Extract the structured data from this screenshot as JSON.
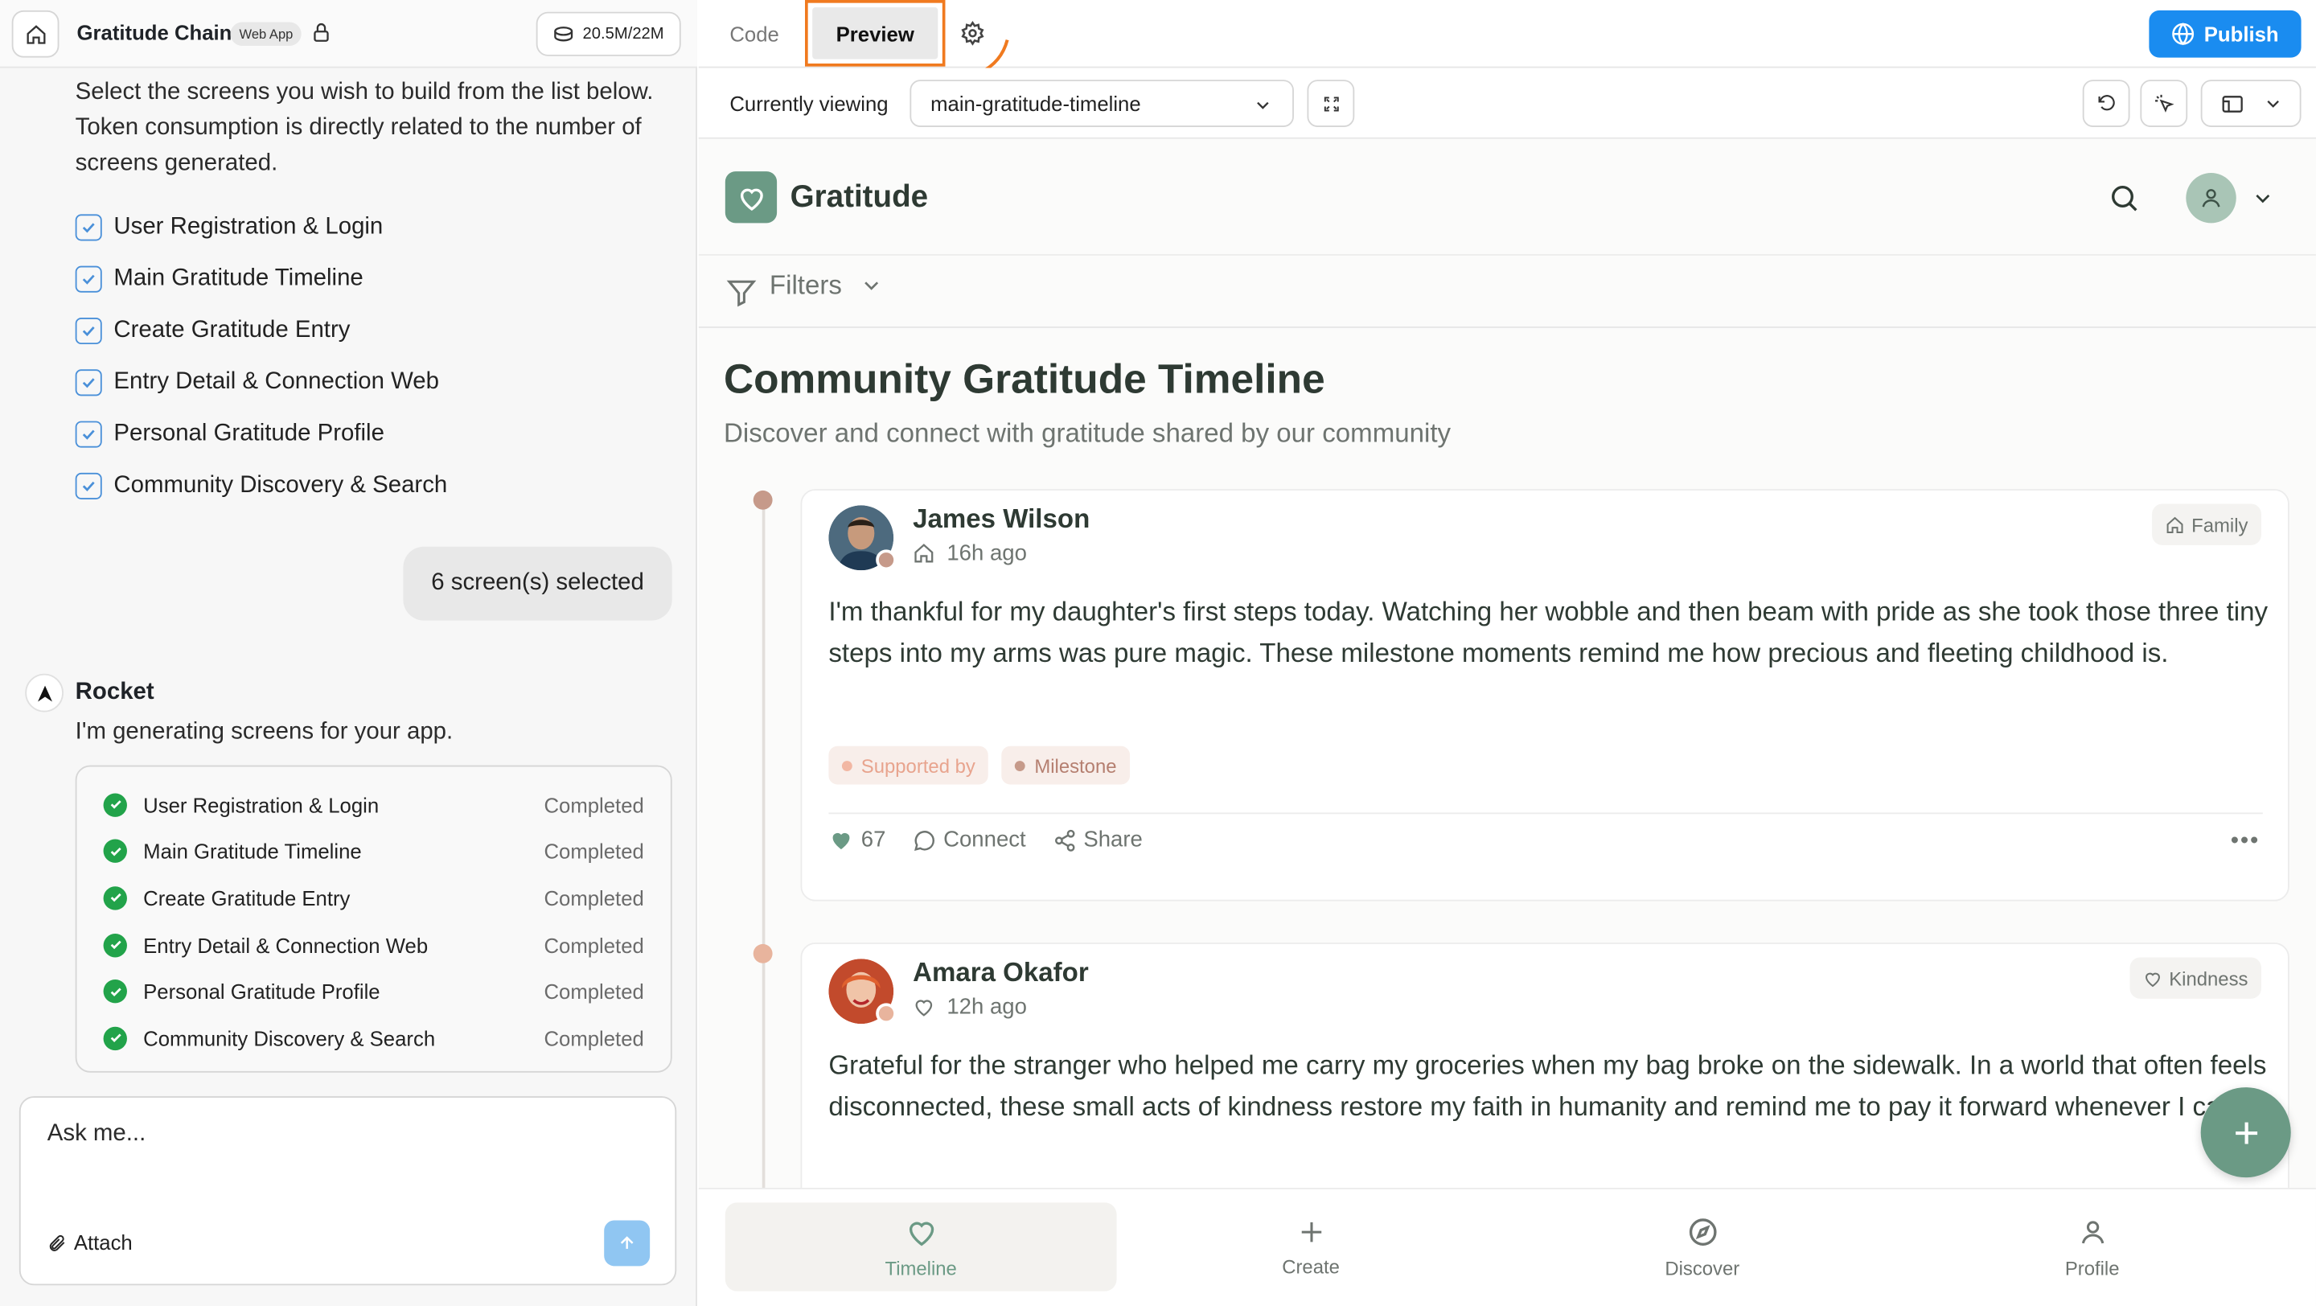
{
  "left": {
    "app_name": "Gratitude Chain",
    "app_badge": "Web App",
    "tokens": "20.5M/22M",
    "intro": "Select the screens you wish to build from the list below. Token consumption is directly related to the number of screens generated.",
    "screens": [
      "User Registration & Login",
      "Main Gratitude Timeline",
      "Create Gratitude Entry",
      "Entry Detail & Connection Web",
      "Personal Gratitude Profile",
      "Community Discovery & Search"
    ],
    "selected_bubble": "6 screen(s) selected",
    "assistant_name": "Rocket",
    "assistant_msg": "I'm generating screens for your app.",
    "progress": [
      {
        "name": "User Registration & Login",
        "status": "Completed"
      },
      {
        "name": "Main Gratitude Timeline",
        "status": "Completed"
      },
      {
        "name": "Create Gratitude Entry",
        "status": "Completed"
      },
      {
        "name": "Entry Detail & Connection Web",
        "status": "Completed"
      },
      {
        "name": "Personal Gratitude Profile",
        "status": "Completed"
      },
      {
        "name": "Community Discovery & Search",
        "status": "Completed"
      }
    ],
    "ask_placeholder": "Ask me...",
    "attach_label": "Attach"
  },
  "topbar": {
    "tab_code": "Code",
    "tab_preview": "Preview",
    "publish": "Publish",
    "currently_viewing_label": "Currently viewing",
    "currently_viewing_value": "main-gratitude-timeline"
  },
  "preview": {
    "brand": "Gratitude",
    "filters_label": "Filters",
    "title": "Community Gratitude Timeline",
    "subtitle": "Discover and connect with gratitude shared by our community",
    "posts": [
      {
        "author": "James Wilson",
        "time": "16h ago",
        "category": "Family",
        "body": "I'm thankful for my daughter's first steps today. Watching her wobble and then beam with pride as she took those three tiny steps into my arms was pure magic. These milestone moments remind me how precious and fleeting childhood is.",
        "tags": [
          "Supported by",
          "Milestone"
        ],
        "likes": "67",
        "connect": "Connect",
        "share": "Share"
      },
      {
        "author": "Amara Okafor",
        "time": "12h ago",
        "category": "Kindness",
        "body": "Grateful for the stranger who helped me carry my groceries when my bag broke on the sidewalk. In a world that often feels disconnected, these small acts of kindness restore my faith in humanity and remind me to pay it forward whenever I can."
      }
    ],
    "nav": [
      "Timeline",
      "Create",
      "Discover",
      "Profile"
    ]
  },
  "colors": {
    "accent_orange": "#f07a1f",
    "publish_blue": "#1a8cf0",
    "brand_green": "#6b9a85",
    "complete_green": "#22a34a"
  }
}
